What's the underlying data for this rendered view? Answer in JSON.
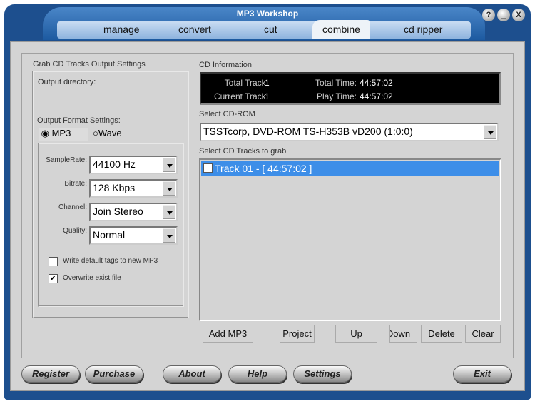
{
  "app": {
    "title": "MP3 Workshop",
    "window_buttons": [
      "?",
      "_",
      "X"
    ]
  },
  "tabs": [
    {
      "label": "manage"
    },
    {
      "label": "convert"
    },
    {
      "label": "cut"
    },
    {
      "label": "combine",
      "active": true
    },
    {
      "label": "cd ripper"
    }
  ],
  "left": {
    "group_title": "Grab CD Tracks Output Settings",
    "output_directory_label": "Output directory:",
    "format_label": "Output Format Settings:",
    "format_options": [
      {
        "label": "MP3",
        "selected": true
      },
      {
        "label": "Wave",
        "selected": false
      }
    ],
    "sample_rate": {
      "label": "SampleRate:",
      "value": "44100 Hz"
    },
    "bitrate": {
      "label": "Bitrate:",
      "value": "128 Kbps"
    },
    "channel": {
      "label": "Channel:",
      "value": "Join Stereo"
    },
    "quality": {
      "label": "Quality:",
      "value": "Normal"
    },
    "write_tags": {
      "label": "Write default tags to new MP3",
      "checked": false
    },
    "overwrite": {
      "label": "Overwrite exist file",
      "checked": true
    }
  },
  "cd_info": {
    "label": "CD Information",
    "total_track_label": "Total Track:",
    "total_track": "1",
    "current_track_label": "Current Track:",
    "current_track": "1",
    "total_time_label": "Total  Time:",
    "total_time": "44:57:02",
    "play_time_label": "Play Time:",
    "play_time": "44:57:02"
  },
  "cdrom": {
    "label": "Select CD-ROM",
    "value": "TSSTcorp, DVD-ROM TS-H353B vD200 (1:0:0)"
  },
  "tracks": {
    "label": "Select CD Tracks to grab",
    "items": [
      {
        "label": "Track 01  -  [ 44:57:02 ]",
        "checked": false,
        "selected": true
      }
    ]
  },
  "actions": [
    "Add MP3",
    "Project",
    "Up",
    "Down",
    "Delete",
    "Clear"
  ],
  "bottom": [
    "Register",
    "Purchase",
    "About",
    "Help",
    "Settings",
    "Exit"
  ],
  "colors": {
    "frame": "#1d4f8e",
    "selection": "#3d8ee8",
    "info_bg": "#000000"
  }
}
